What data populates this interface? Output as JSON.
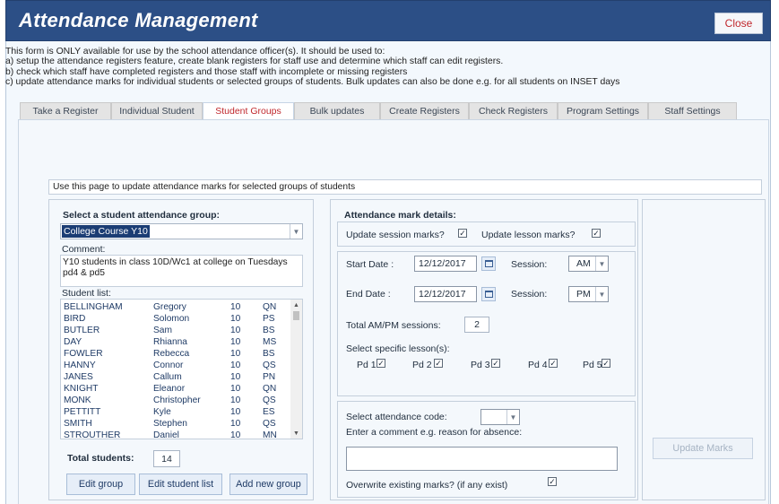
{
  "window": {
    "title": "Attendance Management",
    "close_label": "Close"
  },
  "intro": {
    "lines": [
      "This form is ONLY available for use by the school attendance officer(s). It should be used to:",
      "a) setup the attendance registers feature, create blank registers for staff use and determine which staff can edit registers.",
      "b) check which staff have completed registers and those staff with incomplete or missing registers",
      "c) update attendance marks for individual students or selected groups of students. Bulk updates can also be done e.g. for all students on INSET days"
    ]
  },
  "tabs": [
    {
      "label": "Take a Register"
    },
    {
      "label": "Individual Student"
    },
    {
      "label": "Student Groups",
      "active": true
    },
    {
      "label": "Bulk updates"
    },
    {
      "label": "Create Registers"
    },
    {
      "label": "Check Registers"
    },
    {
      "label": "Program Settings"
    },
    {
      "label": "Staff Settings"
    }
  ],
  "info_text": "Use this page to update attendance marks for selected groups of students",
  "group_panel": {
    "heading": "Select a student attendance group:",
    "selected_group": "College Course Y10",
    "comment_label": "Comment:",
    "comment_text": "Y10 students in class 10D/Wc1 at college on Tuesdays pd4 & pd5",
    "list_label": "Student list:",
    "students": [
      {
        "surname": "BELLINGHAM",
        "forename": "Gregory",
        "year": "10",
        "code": "QN"
      },
      {
        "surname": "BIRD",
        "forename": "Solomon",
        "year": "10",
        "code": "PS"
      },
      {
        "surname": "BUTLER",
        "forename": "Sam",
        "year": "10",
        "code": "BS"
      },
      {
        "surname": "DAY",
        "forename": "Rhianna",
        "year": "10",
        "code": "MS"
      },
      {
        "surname": "FOWLER",
        "forename": "Rebecca",
        "year": "10",
        "code": "BS"
      },
      {
        "surname": "HANNY",
        "forename": "Connor",
        "year": "10",
        "code": "QS"
      },
      {
        "surname": "JANES",
        "forename": "Callum",
        "year": "10",
        "code": "PN"
      },
      {
        "surname": "KNIGHT",
        "forename": "Eleanor",
        "year": "10",
        "code": "QN"
      },
      {
        "surname": "MONK",
        "forename": "Christopher",
        "year": "10",
        "code": "QS"
      },
      {
        "surname": "PETTITT",
        "forename": "Kyle",
        "year": "10",
        "code": "ES"
      },
      {
        "surname": "SMITH",
        "forename": "Stephen",
        "year": "10",
        "code": "QS"
      },
      {
        "surname": "STROUTHER",
        "forename": "Daniel",
        "year": "10",
        "code": "MN"
      }
    ],
    "total_label": "Total students:",
    "total_value": "14",
    "buttons": {
      "edit_group": "Edit group",
      "edit_list": "Edit student list",
      "add_group": "Add new group"
    }
  },
  "mark_panel": {
    "heading": "Attendance mark details:",
    "update_session_label": "Update session marks?",
    "update_session_checked": true,
    "update_lesson_label": "Update lesson marks?",
    "update_lesson_checked": true,
    "start_date_label": "Start Date :",
    "start_date": "12/12/2017",
    "start_session_label": "Session:",
    "start_session": "AM",
    "end_date_label": "End Date :",
    "end_date": "12/12/2017",
    "end_session_label": "Session:",
    "end_session": "PM",
    "total_sessions_label": "Total AM/PM sessions:",
    "total_sessions": "2",
    "lessons_label": "Select specific lesson(s):",
    "lessons": [
      {
        "label": "Pd 1",
        "checked": true
      },
      {
        "label": "Pd 2",
        "checked": true
      },
      {
        "label": "Pd 3",
        "checked": true
      },
      {
        "label": "Pd 4",
        "checked": true
      },
      {
        "label": "Pd 5",
        "checked": true
      }
    ],
    "code_label": "Select attendance code:",
    "code_value": "",
    "comment_label": "Enter a comment e.g. reason for absence:",
    "comment_value": "",
    "overwrite_label": "Overwrite existing marks? (if any exist)",
    "overwrite_checked": true
  },
  "update_button": "Update Marks",
  "icons": {
    "dropdown": "chevron-down-icon",
    "calendar": "calendar-icon",
    "check": "checkmark-icon"
  },
  "colors": {
    "title_bar": "#2c4f86",
    "active_tab_text": "#c0282d",
    "selection": "#1b3d74"
  }
}
